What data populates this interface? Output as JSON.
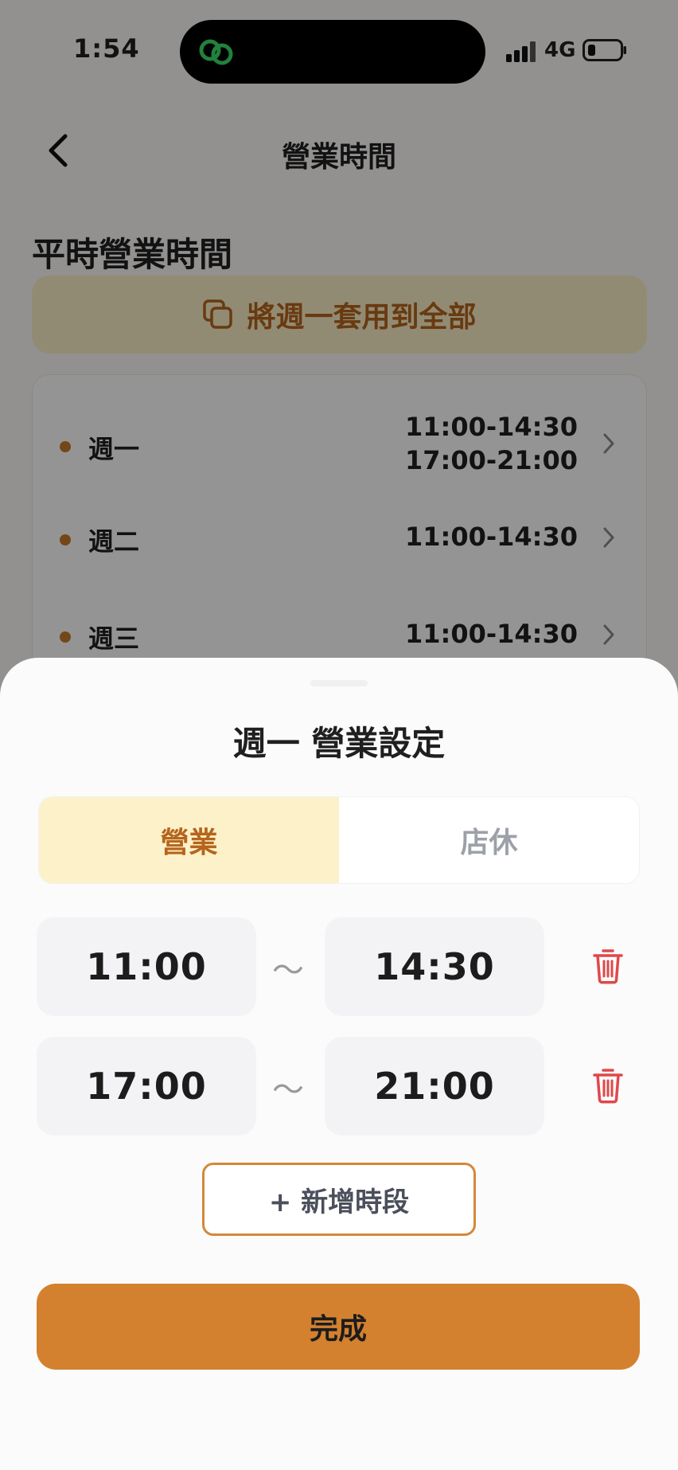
{
  "status_bar": {
    "time": "1:54",
    "network": "4G"
  },
  "nav": {
    "title": "營業時間"
  },
  "section_title": "平時營業時間",
  "apply_all_label": "將週一套用到全部",
  "days": [
    {
      "label": "週一",
      "times": [
        "11:00-14:30",
        "17:00-21:00"
      ]
    },
    {
      "label": "週二",
      "times": [
        "11:00-14:30"
      ]
    },
    {
      "label": "週三",
      "times": [
        "11:00-14:30"
      ]
    }
  ],
  "sheet": {
    "title": "週一 營業設定",
    "segment_open": "營業",
    "segment_closed": "店休",
    "selected_segment": "營業",
    "separator": "～",
    "slots": [
      {
        "start": "11:00",
        "end": "14:30"
      },
      {
        "start": "17:00",
        "end": "21:00"
      }
    ],
    "add_slot_label": "+ 新增時段",
    "done_label": "完成"
  },
  "colors": {
    "accent": "#d4812f",
    "accent_text": "#b5651d",
    "accent_light": "#fdf1c9",
    "delete": "#e0484a",
    "dot": "#c87a2c",
    "island_logo": "#3ddc6a"
  },
  "icons": {
    "back": "chevron-left-icon",
    "apply_all": "copy-icon",
    "row_chevron": "chevron-right-icon",
    "delete": "trash-icon"
  }
}
